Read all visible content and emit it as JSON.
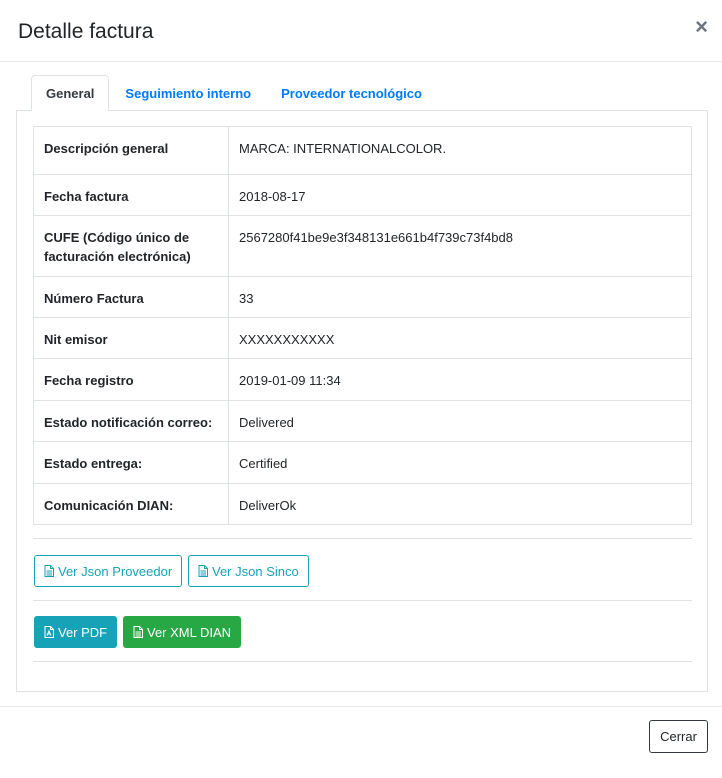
{
  "modal": {
    "title": "Detalle factura",
    "close_symbol": "×"
  },
  "tabs": [
    {
      "label": "General",
      "active": true
    },
    {
      "label": "Seguimiento interno",
      "active": false
    },
    {
      "label": "Proveedor tecnológico",
      "active": false
    }
  ],
  "details": [
    {
      "label": "Descripción general",
      "value": "MARCA: INTERNATIONALCOLOR."
    },
    {
      "label": "Fecha factura",
      "value": "2018-08-17"
    },
    {
      "label": "CUFE (Código único de facturación electrónica)",
      "value": "2567280f41be9e3f348131e661b4f739c73f4bd8"
    },
    {
      "label": "Número Factura",
      "value": "33"
    },
    {
      "label": "Nit emisor",
      "value": "XXXXXXXXXXX"
    },
    {
      "label": "Fecha registro",
      "value": "2019-01-09 11:34"
    },
    {
      "label": "Estado notificación correo:",
      "value": "Delivered"
    },
    {
      "label": "Estado entrega:",
      "value": "Certified"
    },
    {
      "label": "Comunicación DIAN:",
      "value": "DeliverOk"
    }
  ],
  "buttons": {
    "json_proveedor": "Ver Json Proveedor",
    "json_sinco": "Ver Json Sinco",
    "pdf": "Ver PDF",
    "xml_dian": "Ver XML DIAN"
  },
  "footer": {
    "close_label": "Cerrar"
  },
  "colors": {
    "link": "#007bff",
    "info": "#17a2b8",
    "success": "#28a745",
    "border": "#dee2e6"
  },
  "icons": {
    "file": "file-text-icon",
    "pdf": "file-pdf-icon",
    "close": "close-icon"
  }
}
